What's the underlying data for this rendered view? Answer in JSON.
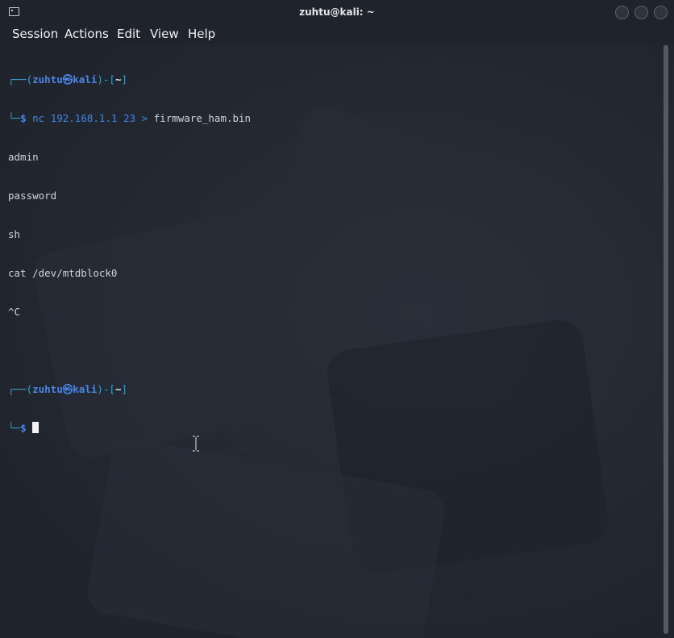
{
  "window": {
    "title": "zuhtu@kali: ~"
  },
  "menubar": {
    "items": [
      "Session",
      "Actions",
      "Edit",
      "View",
      "Help"
    ]
  },
  "terminal": {
    "prompt1": {
      "open": "┌──(",
      "user": "zuhtu",
      "at": "㉿",
      "host": "kali",
      "mid": ")-[",
      "dir": "~",
      "close": "]",
      "corner": "└─",
      "dollar": "$",
      "command": "nc 192.168.1.1 23",
      "redirect": ">",
      "target": "firmware_ham.bin"
    },
    "output": [
      "admin",
      "password",
      "sh",
      "cat /dev/mtdblock0",
      "^C"
    ],
    "prompt2": {
      "open": "┌──(",
      "user": "zuhtu",
      "at": "㉿",
      "host": "kali",
      "mid": ")-[",
      "dir": "~",
      "close": "]",
      "corner": "└─",
      "dollar": "$"
    }
  },
  "colors": {
    "background": "#232831",
    "prompt_frame": "#3ba0c8",
    "prompt_user": "#4a86e8",
    "text": "#cfd3d9"
  }
}
